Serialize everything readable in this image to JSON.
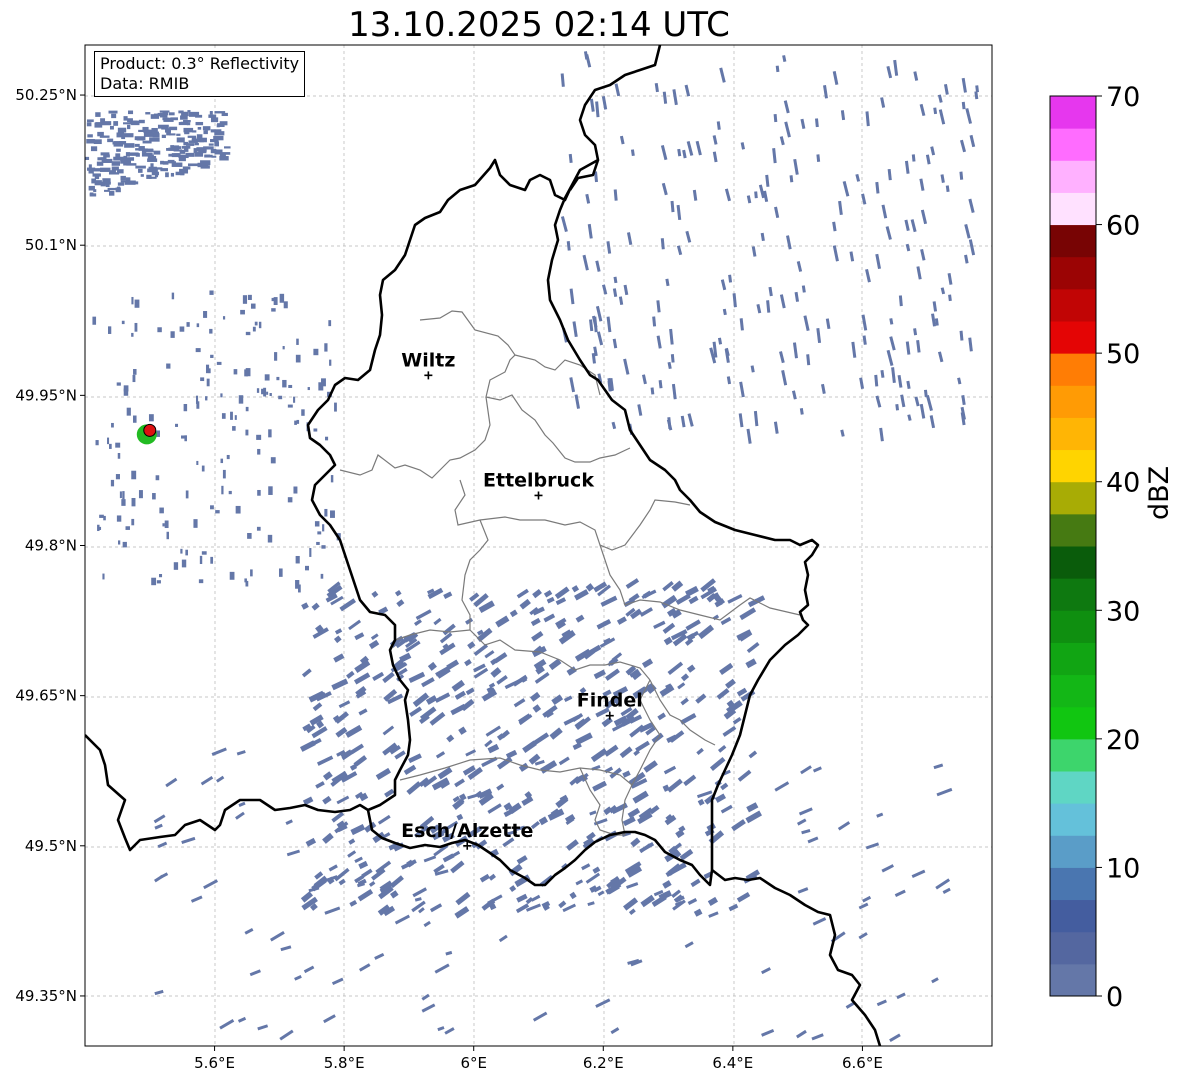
{
  "title": "13.10.2025 02:14 UTC",
  "info": {
    "product_line": "Product: 0.3° Reflectivity",
    "data_line": "Data: RMIB"
  },
  "axes": {
    "lon_ticks": [
      "5.6°E",
      "5.8°E",
      "6°E",
      "6.2°E",
      "6.4°E",
      "6.6°E"
    ],
    "lat_ticks": [
      "50.25°N",
      "50.1°N",
      "49.95°N",
      "49.8°N",
      "49.65°N",
      "49.5°N",
      "49.35°N"
    ],
    "lon_range": [
      5.4,
      6.8
    ],
    "lat_range": [
      49.3,
      50.3
    ],
    "grid": true
  },
  "cities": [
    {
      "name": "Wiltz",
      "lon": 5.93,
      "lat": 49.97
    },
    {
      "name": "Ettelbruck",
      "lon": 6.1,
      "lat": 49.85
    },
    {
      "name": "Findel",
      "lon": 6.21,
      "lat": 49.63
    },
    {
      "name": "Esch/Alzette",
      "lon": 5.99,
      "lat": 49.5
    }
  ],
  "radar_site": {
    "lon": 5.5,
    "lat": 49.915,
    "color": "#dd1111",
    "halo": "#22bb22"
  },
  "colorbar": {
    "label": "dBZ",
    "ticks": [
      "0",
      "10",
      "20",
      "30",
      "40",
      "50",
      "60",
      "70"
    ],
    "min": 0,
    "max": 70,
    "step": 2.5,
    "colors": [
      "#6477a8",
      "#5467a0",
      "#445d9f",
      "#4a76b0",
      "#5a9dc8",
      "#64c1da",
      "#5fd6c4",
      "#3dd56c",
      "#11c611",
      "#13b716",
      "#11a513",
      "#0f8f10",
      "#0e7910",
      "#0a5c0b",
      "#467a12",
      "#a8ac05",
      "#ffd400",
      "#ffb505",
      "#ff9b05",
      "#ff7d05",
      "#e40505",
      "#c10505",
      "#9b0404",
      "#780404",
      "#ffe1ff",
      "#ffb1ff",
      "#ff6cff",
      "#e637ee"
    ]
  },
  "echo_color": "#6477a8",
  "border_color": "#000000",
  "district_color": "#7a7a7a"
}
